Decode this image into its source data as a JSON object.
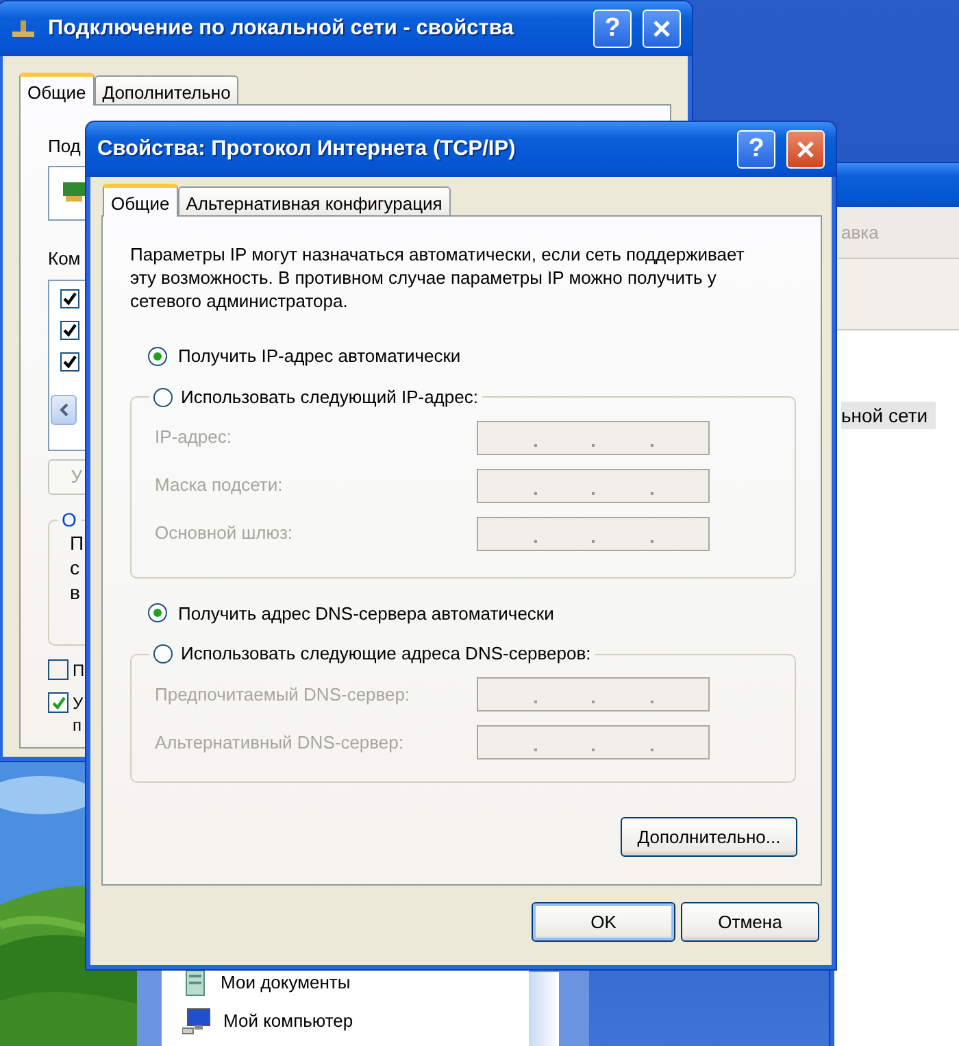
{
  "lan_window": {
    "title": "Подключение по локальной сети - свойства",
    "help_glyph": "?",
    "tabs": [
      {
        "label": "Общие",
        "selected": true
      },
      {
        "label": "Дополнительно",
        "selected": false
      }
    ],
    "connect_label": "Под",
    "components_label": "Ком",
    "components": [
      {
        "checked": true
      },
      {
        "checked": true
      },
      {
        "checked": true
      }
    ],
    "button": "У",
    "group_label": "О",
    "group_lines": [
      "П",
      "с",
      "в"
    ],
    "options": [
      {
        "checked": false,
        "lines": [
          "П"
        ]
      },
      {
        "checked": true,
        "lines": [
          "У",
          "п"
        ]
      }
    ]
  },
  "right_window": {
    "tab_fragment": "авка",
    "item_fragment": "ьной сети"
  },
  "explorer": {
    "items": [
      {
        "label": "Мои документы",
        "kind": "documents"
      },
      {
        "label": "Мой компьютер",
        "kind": "computer"
      }
    ]
  },
  "tcp_dialog": {
    "title": "Свойства: Протокол Интернета (TCP/IP)",
    "help_glyph": "?",
    "tabs": [
      {
        "label": "Общие",
        "selected": true
      },
      {
        "label": "Альтернативная конфигурация",
        "selected": false
      }
    ],
    "intro": "Параметры IP могут назначаться автоматически, если сеть поддерживает эту возможность. В противном случае параметры IP можно получить у сетевого администратора.",
    "ip_modes": [
      {
        "label": "Получить IP-адрес автоматически",
        "selected": true
      },
      {
        "label": "Использовать следующий IP-адрес:",
        "selected": false
      }
    ],
    "ip_fields": [
      {
        "label": "IP-адрес:",
        "disabled": true
      },
      {
        "label": "Маска подсети:",
        "disabled": true
      },
      {
        "label": "Основной шлюз:",
        "disabled": true
      }
    ],
    "dns_modes": [
      {
        "label": "Получить адрес DNS-сервера автоматически",
        "selected": true
      },
      {
        "label": "Использовать следующие адреса DNS-серверов:",
        "selected": false
      }
    ],
    "dns_fields": [
      {
        "label": "Предпочитаемый DNS-сервер:",
        "disabled": true
      },
      {
        "label": "Альтернативный DNS-сервер:",
        "disabled": true
      }
    ],
    "advanced_button": "Дополнительно...",
    "ok_button": "OK",
    "cancel_button": "Отмена"
  }
}
